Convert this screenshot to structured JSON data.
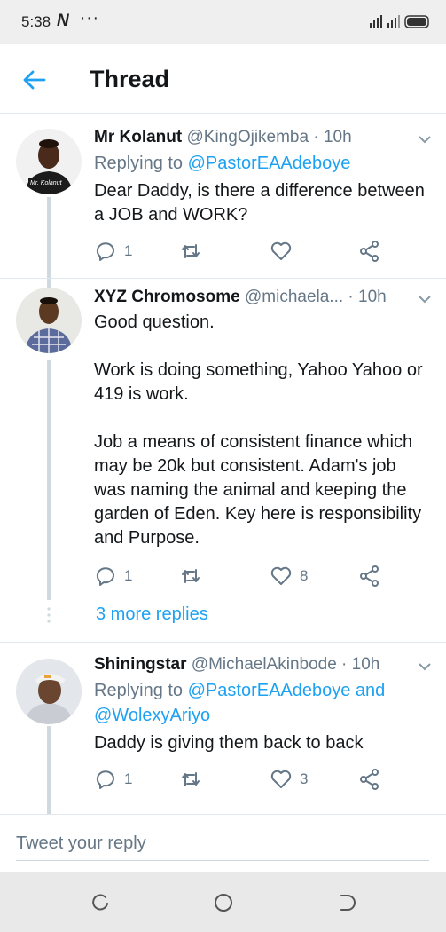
{
  "status_bar": {
    "time": "5:38",
    "app_icon": "N",
    "more": "···"
  },
  "header": {
    "title": "Thread"
  },
  "tweets": [
    {
      "name": "Mr Kolanut",
      "handle": "@KingOjikemba · 10h",
      "reply_prefix": "Replying to ",
      "reply_to": "@PastorEAAdeboye",
      "body": "Dear Daddy, is there a difference between a JOB and WORK?",
      "replies": "1",
      "retweets": "",
      "likes": "",
      "avatar_label": "Mr. Kolanut"
    },
    {
      "name": "XYZ Chromosome",
      "handle": "@michaela... · 10h",
      "body": "Good question.\n\nWork is doing something, Yahoo Yahoo or 419 is work.\n\nJob a means of consistent finance which may be 20k but consistent. Adam's job was naming the animal and keeping the garden of Eden. Key here is responsibility and Purpose.",
      "replies": "1",
      "retweets": "",
      "likes": "8"
    },
    {
      "name": "Shiningstar",
      "handle": "@MichaelAkinbode · 10h",
      "reply_prefix": "Replying to ",
      "reply_to": "@PastorEAAdeboye and",
      "reply_to_2": "@WolexyAriyo",
      "body": "Daddy is giving them back to back",
      "replies": "1",
      "retweets": "",
      "likes": "3"
    }
  ],
  "more_replies": "3 more replies",
  "reply_box": {
    "placeholder": "Tweet your reply"
  },
  "icons": [
    "back-arrow-icon",
    "chevron-down-icon",
    "reply-icon",
    "retweet-icon",
    "like-icon",
    "share-icon",
    "signal-icon",
    "battery-icon"
  ],
  "colors": {
    "accent": "#1da1f2",
    "muted": "#657786",
    "thread_line": "#cfd9de"
  }
}
